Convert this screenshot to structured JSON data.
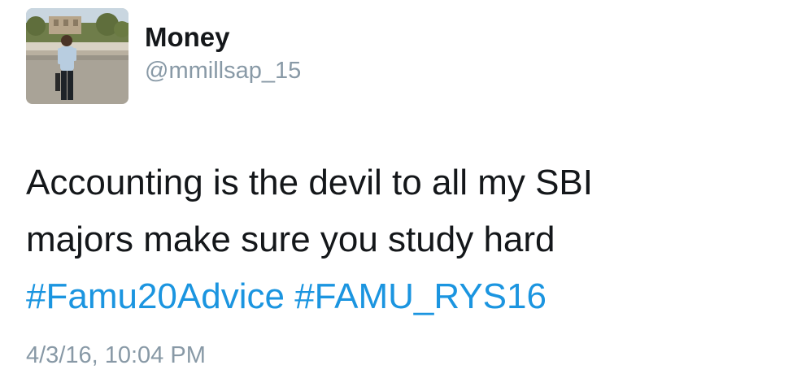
{
  "user": {
    "display_name": "Money",
    "handle": "@mmillsap_15"
  },
  "tweet": {
    "lines": [
      "Accounting is the devil to all my SBI",
      "majors make sure you study hard"
    ],
    "hashtags": [
      "#Famu20Advice",
      "#FAMU_RYS16"
    ],
    "timestamp": "4/3/16, 10:04 PM"
  },
  "colors": {
    "text": "#14171a",
    "secondary": "#8899a6",
    "hashtag": "#1b95e0"
  }
}
